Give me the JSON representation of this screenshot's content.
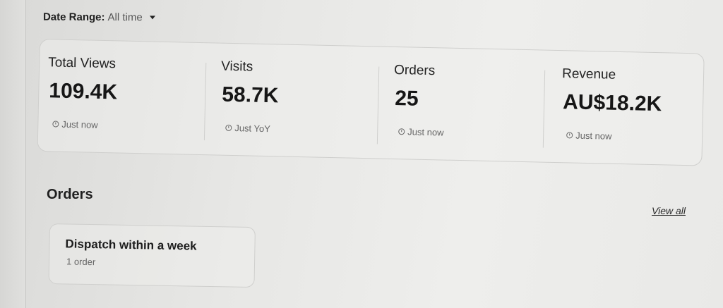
{
  "filter": {
    "label": "Date Range:",
    "value": "All time"
  },
  "stats": [
    {
      "title": "Total Views",
      "value": "109.4K",
      "meta": "Just now"
    },
    {
      "title": "Visits",
      "value": "58.7K",
      "meta": "Just YoY"
    },
    {
      "title": "Orders",
      "value": "25",
      "meta": "Just now"
    },
    {
      "title": "Revenue",
      "value": "AU$18.2K",
      "meta": "Just now"
    }
  ],
  "orders": {
    "title": "Orders",
    "view_all": "View all",
    "card": {
      "title": "Dispatch within a week",
      "subtitle": "1 order"
    }
  }
}
